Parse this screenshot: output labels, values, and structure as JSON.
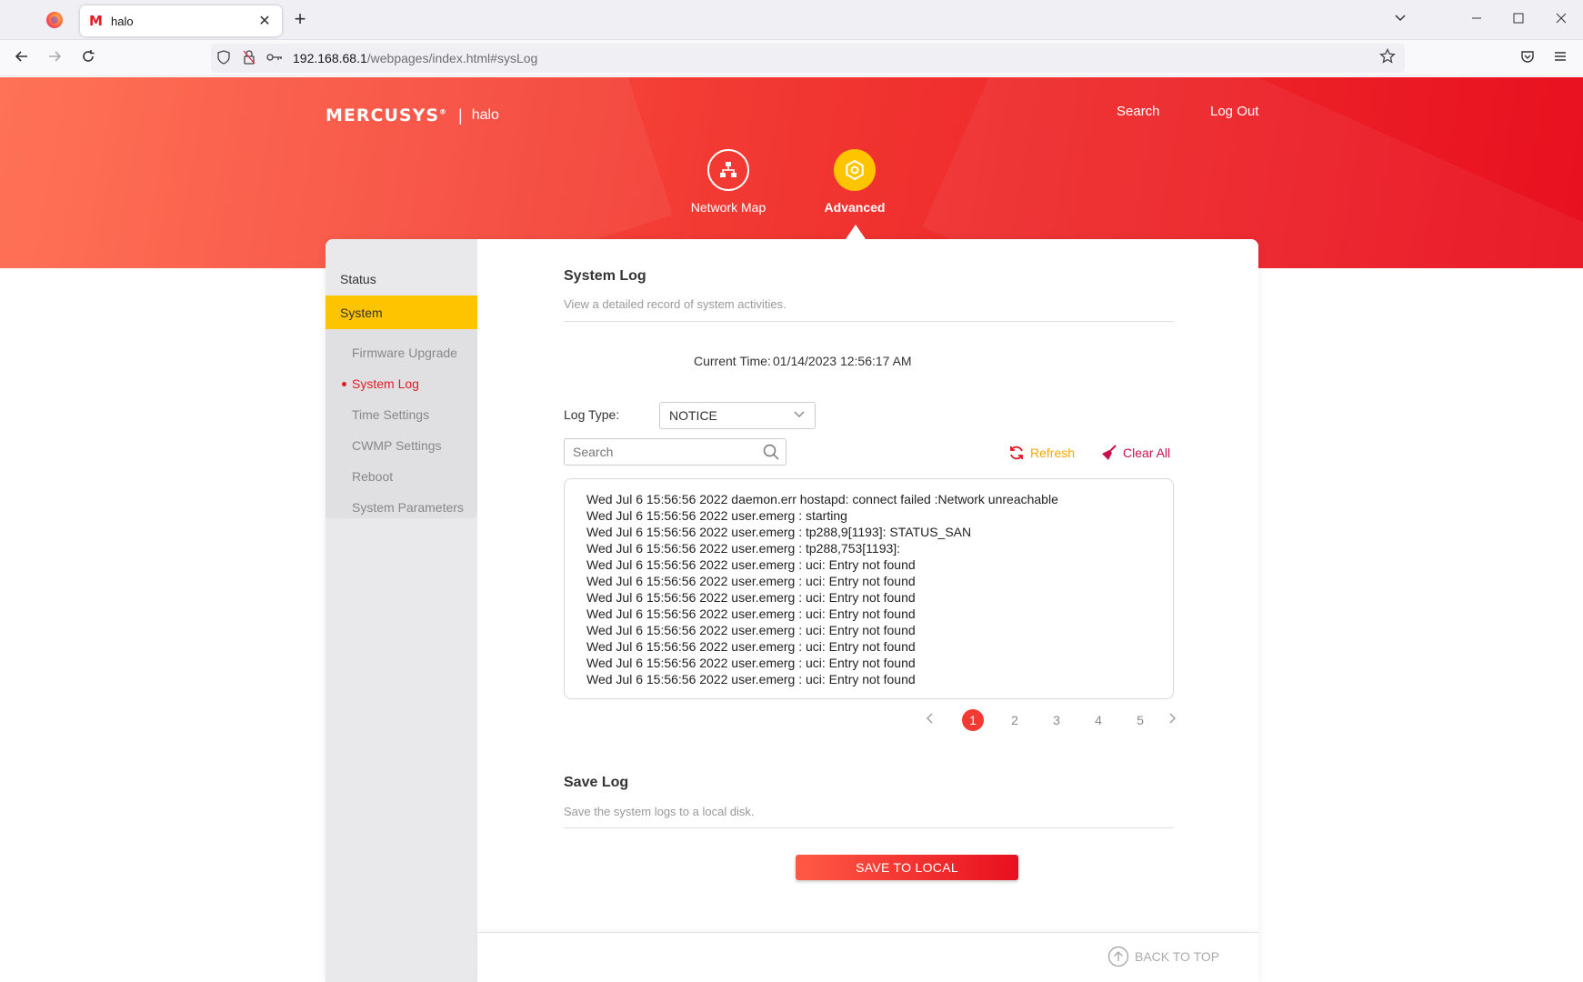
{
  "browser": {
    "tab_title": "halo",
    "tab_favicon": "M",
    "url_host": "192.168.68.1",
    "url_path": "/webpages/index.html#sysLog"
  },
  "header": {
    "brand": "MERCUSYS",
    "brand_mark": "®",
    "separator": "|",
    "model": "halo",
    "search_link": "Search",
    "logout_link": "Log Out",
    "nav": {
      "network_map": "Network Map",
      "advanced": "Advanced"
    }
  },
  "sidebar": {
    "status": "Status",
    "system": "System",
    "items": [
      {
        "label": "Firmware Upgrade"
      },
      {
        "label": "System Log"
      },
      {
        "label": "Time Settings"
      },
      {
        "label": "CWMP Settings"
      },
      {
        "label": "Reboot"
      },
      {
        "label": "System Parameters"
      }
    ],
    "active_item": "System Log"
  },
  "system_log": {
    "title": "System Log",
    "description": "View a detailed record of system activities.",
    "current_time_label": "Current Time:",
    "current_time_value": "01/14/2023 12:56:17 AM",
    "log_type_label": "Log Type:",
    "log_type_value": "NOTICE",
    "search_placeholder": "Search",
    "refresh_label": "Refresh",
    "clear_all_label": "Clear All",
    "entries": [
      "Wed Jul 6 15:56:56 2022 daemon.err hostapd: connect failed :Network unreachable",
      "Wed Jul 6 15:56:56 2022 user.emerg : starting",
      "Wed Jul 6 15:56:56 2022 user.emerg : tp288,9[1193]: STATUS_SAN",
      "Wed Jul 6 15:56:56 2022 user.emerg : tp288,753[1193]:",
      "Wed Jul 6 15:56:56 2022 user.emerg : uci: Entry not found",
      "Wed Jul 6 15:56:56 2022 user.emerg : uci: Entry not found",
      "Wed Jul 6 15:56:56 2022 user.emerg : uci: Entry not found",
      "Wed Jul 6 15:56:56 2022 user.emerg : uci: Entry not found",
      "Wed Jul 6 15:56:56 2022 user.emerg : uci: Entry not found",
      "Wed Jul 6 15:56:56 2022 user.emerg : uci: Entry not found",
      "Wed Jul 6 15:56:56 2022 user.emerg : uci: Entry not found",
      "Wed Jul 6 15:56:56 2022 user.emerg : uci: Entry not found"
    ],
    "pages": [
      "1",
      "2",
      "3",
      "4",
      "5"
    ],
    "current_page": "1"
  },
  "save_log": {
    "title": "Save Log",
    "description": "Save the system logs to a local disk.",
    "button_label": "SAVE TO LOCAL"
  },
  "footer": {
    "back_to_top": "BACK TO TOP"
  },
  "colors": {
    "accent_red": "#e8101f",
    "accent_yellow": "#ffc400",
    "refresh_color": "#f5a800",
    "clear_color": "#c8104e"
  }
}
